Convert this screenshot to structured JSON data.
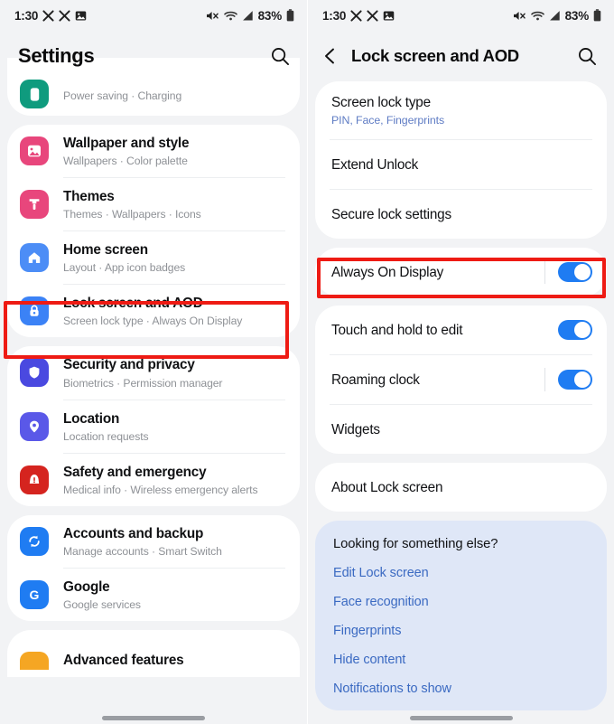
{
  "statusbar": {
    "time": "1:30",
    "left_icons": [
      "x-icon",
      "x-icon",
      "image-icon"
    ],
    "right_icons": [
      "mute-icon",
      "wifi-icon",
      "signal-icon"
    ],
    "battery": "83%"
  },
  "left_screen": {
    "title": "Settings",
    "search_icon": "search-icon",
    "partial_top_row": {
      "subtitle": "Power saving  ·  Charging",
      "icon": "battery-icon",
      "icon_color": "#0f9b7e"
    },
    "groups": [
      {
        "items": [
          {
            "title": "Wallpaper and style",
            "subtitle": "Wallpapers  ·  Color palette",
            "icon": "wallpaper-icon",
            "icon_color": "#e8467c"
          },
          {
            "title": "Themes",
            "subtitle": "Themes  ·  Wallpapers  ·  Icons",
            "icon": "themes-icon",
            "icon_color": "#e8467c"
          },
          {
            "title": "Home screen",
            "subtitle": "Layout  ·  App icon badges",
            "icon": "home-icon",
            "icon_color": "#4c8df6"
          },
          {
            "title": "Lock screen and AOD",
            "subtitle": "Screen lock type  ·  Always On Display",
            "icon": "lock-icon",
            "icon_color": "#3b82f6",
            "highlighted": true
          }
        ]
      },
      {
        "items": [
          {
            "title": "Security and privacy",
            "subtitle": "Biometrics  ·  Permission manager",
            "icon": "shield-icon",
            "icon_color": "#4a49e0"
          },
          {
            "title": "Location",
            "subtitle": "Location requests",
            "icon": "pin-icon",
            "icon_color": "#5a58e8"
          },
          {
            "title": "Safety and emergency",
            "subtitle": "Medical info  ·  Wireless emergency alerts",
            "icon": "alert-icon",
            "icon_color": "#d5241f"
          }
        ]
      },
      {
        "items": [
          {
            "title": "Accounts and backup",
            "subtitle": "Manage accounts  ·  Smart Switch",
            "icon": "sync-icon",
            "icon_color": "#1f7cf2"
          },
          {
            "title": "Google",
            "subtitle": "Google services",
            "icon": "google-icon",
            "icon_color": "#1f7cf2"
          }
        ]
      },
      {
        "items": [
          {
            "title": "Advanced features",
            "subtitle": "",
            "icon": "advanced-icon",
            "icon_color": "#f5a623"
          }
        ]
      }
    ]
  },
  "right_screen": {
    "title": "Lock screen and AOD",
    "back_icon": "chevron-left-icon",
    "search_icon": "search-icon",
    "groups": [
      {
        "items": [
          {
            "title": "Screen lock type",
            "subtitle": "PIN, Face, Fingerprints",
            "toggle": null
          },
          {
            "title": "Extend Unlock",
            "subtitle": "",
            "toggle": null
          },
          {
            "title": "Secure lock settings",
            "subtitle": "",
            "toggle": null
          }
        ]
      },
      {
        "items": [
          {
            "title": "Always On Display",
            "subtitle": "",
            "toggle": "on",
            "highlighted": true
          }
        ]
      },
      {
        "items": [
          {
            "title": "Touch and hold to edit",
            "subtitle": "",
            "toggle": "on"
          },
          {
            "title": "Roaming clock",
            "subtitle": "",
            "toggle": "on"
          },
          {
            "title": "Widgets",
            "subtitle": "",
            "toggle": null
          }
        ]
      },
      {
        "items": [
          {
            "title": "About Lock screen",
            "subtitle": "",
            "toggle": null
          }
        ]
      }
    ],
    "tip": {
      "title": "Looking for something else?",
      "links": [
        "Edit Lock screen",
        "Face recognition",
        "Fingerprints",
        "Hide content",
        "Notifications to show"
      ]
    }
  },
  "colors": {
    "highlight": "#ee1b14",
    "toggle_on": "#1f7cf2",
    "link": "#3b6ac2",
    "tip_bg": "#dfe7f7",
    "page_bg": "#f2f3f5"
  }
}
